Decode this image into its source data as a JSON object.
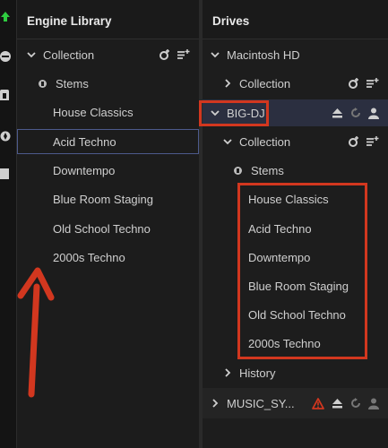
{
  "library": {
    "title": "Engine Library",
    "collection_label": "Collection",
    "stems_label": "Stems",
    "playlists": [
      "House Classics",
      "Acid Techno",
      "Downtempo",
      "Blue Room Staging",
      "Old School Techno",
      "2000s Techno"
    ],
    "selected_playlist": "Acid Techno"
  },
  "drives": {
    "title": "Drives",
    "mac": {
      "name": "Macintosh HD",
      "collection_label": "Collection"
    },
    "bigdj": {
      "name": "BIG-DJ",
      "collection_label": "Collection",
      "stems_label": "Stems",
      "playlists": [
        "House Classics",
        "Acid Techno",
        "Downtempo",
        "Blue Room Staging",
        "Old School Techno",
        "2000s Techno"
      ],
      "history_label": "History"
    },
    "music": {
      "name": "MUSIC_SY..."
    }
  },
  "colors": {
    "annotation_red": "#d2371f",
    "accent_green": "#2ecc40",
    "selection_border": "#4d5a8c"
  }
}
